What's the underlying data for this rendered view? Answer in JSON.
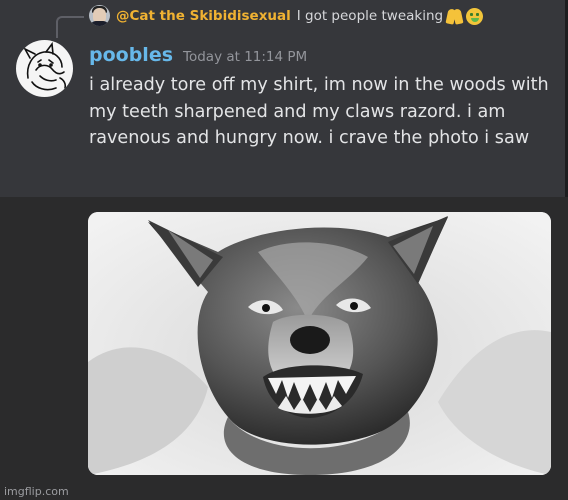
{
  "reply": {
    "author": "@Cat the Skibidisexual",
    "text": "I got people tweaking",
    "emojis": [
      "folded-hands-emoji",
      "money-mouth-face-emoji"
    ]
  },
  "message": {
    "author": "poobles",
    "timestamp": "Today at 11:14 PM",
    "text": "i already tore off my shirt, im now in the woods with my teeth sharpened and my claws razord. i am ravenous and hungry now. i crave the photo i saw"
  },
  "attachment": {
    "subject": "snarling-wolf"
  },
  "watermark": "imgflip.com",
  "colors": {
    "reply_author": "#f0b232",
    "author": "#67b8ea",
    "timestamp": "#93959b",
    "message_bg": "#36373b"
  }
}
